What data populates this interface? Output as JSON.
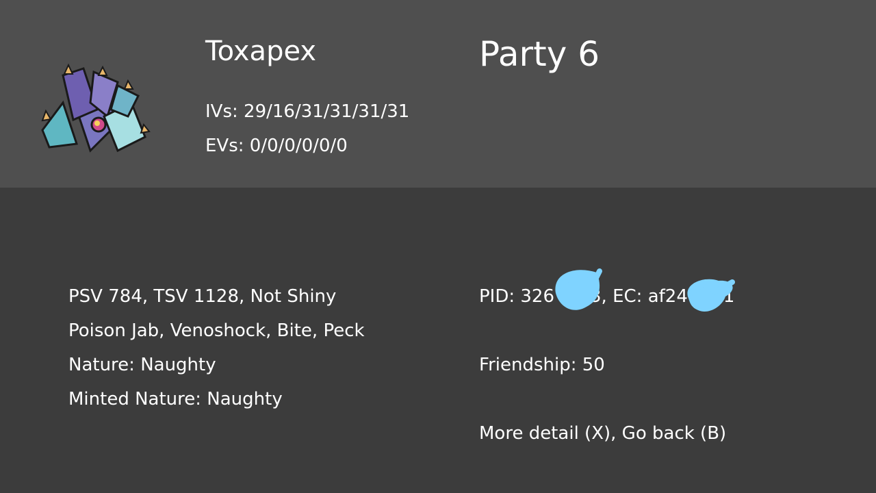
{
  "pokemon": {
    "name": "Toxapex",
    "ivs": "IVs: 29/16/31/31/31/31",
    "evs": "EVs: 0/0/0/0/0/0",
    "sprite_icon": "toxapex-sprite-icon"
  },
  "slot": "Party 6",
  "details": {
    "shiny_info": "PSV 784, TSV 1128, Not Shiny",
    "moves": "Poison Jab, Venoshock, Bite, Peck",
    "nature": "Nature: Naughty",
    "minted_nature": "Minted Nature: Naughty"
  },
  "ids": {
    "pid_ec": "PID: 326    3, EC: af24    1",
    "friendship": "Friendship: 50"
  },
  "controls": {
    "hint": "More detail (X), Go back (B)"
  },
  "colors": {
    "header_bg": "#4f4f4f",
    "body_bg": "#3c3c3c",
    "redaction": "#7fd3ff"
  }
}
